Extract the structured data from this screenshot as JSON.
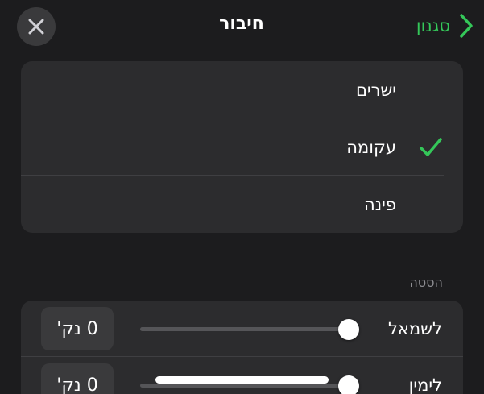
{
  "header": {
    "title": "חיבור",
    "back_label": "סגנון",
    "colors": {
      "accent": "#34c759",
      "background": "#1c1c1e",
      "card": "#2c2c2e"
    }
  },
  "connection": {
    "options": [
      {
        "label": "ישרים",
        "selected": false
      },
      {
        "label": "עקומה",
        "selected": true
      },
      {
        "label": "פינה",
        "selected": false
      }
    ]
  },
  "offset": {
    "section_label": "הסטה",
    "rows": [
      {
        "label": "לשמאל",
        "value": "0 נק'",
        "slider_fraction": 1.0
      },
      {
        "label": "לימין",
        "value": "0 נק'",
        "slider_fraction": 1.0
      }
    ]
  },
  "icons": {
    "close": "close-icon",
    "back": "chevron-right-icon",
    "check": "checkmark-icon"
  }
}
